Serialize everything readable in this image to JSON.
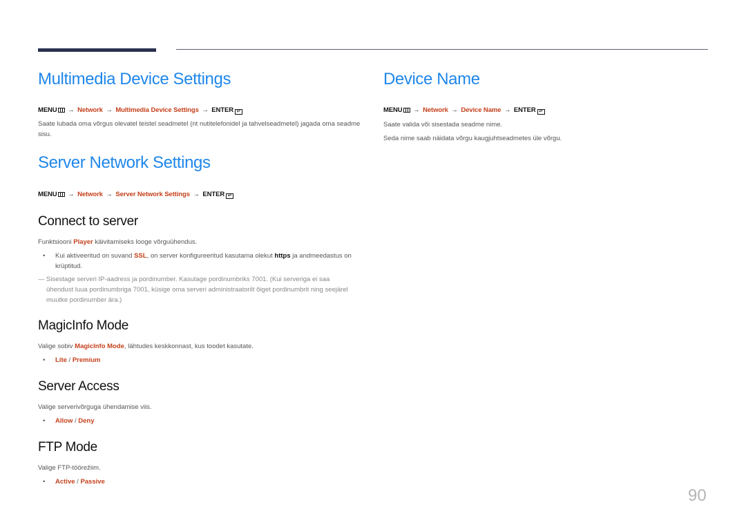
{
  "page_number": "90",
  "sections": {
    "multimedia": {
      "title": "Multimedia Device Settings",
      "path": {
        "menu": "MENU",
        "network": "Network",
        "item": "Multimedia Device Settings",
        "enter": "ENTER",
        "arrow": "→"
      },
      "description": "Saate lubada oma võrgus olevatel teistel seadmetel (nt nutitelefonidel ja tahvelseadmetel) jagada oma seadme sisu."
    },
    "server_network": {
      "title": "Server Network Settings",
      "path": {
        "menu": "MENU",
        "network": "Network",
        "item": "Server Network Settings",
        "enter": "ENTER",
        "arrow": "→"
      }
    },
    "connect_to_server": {
      "title": "Connect to server",
      "desc_pre": "Funktsiooni ",
      "desc_highlight": "Player",
      "desc_post": " käivitamiseks looge võrguühendus.",
      "bullet_pre": "Kui aktiveeritud on suvand ",
      "bullet_ssl": "SSL",
      "bullet_mid": ", on server konfigureeritud kasutama olekut ",
      "bullet_https": "https",
      "bullet_post": " ja andmeedastus on krüptitud.",
      "note": "Sisestage serveri IP-aadress ja pordinumber. Kasutage pordinumbriks 7001. (Kui serveriga ei saa ühendust luua pordinumbriga 7001, küsige oma serveri administraatorilt õiget pordinumbrit ning seejärel muutke pordinumber ära.)"
    },
    "magicinfo_mode": {
      "title": "MagicInfo Mode",
      "desc_pre": "Valige sobiv ",
      "desc_highlight": "MagicInfo Mode",
      "desc_post": ", lähtudes keskkonnast, kus toodet kasutate.",
      "options": [
        "Lite",
        "Premium"
      ]
    },
    "server_access": {
      "title": "Server Access",
      "description": "Valige serverivõrguga ühendamise viis.",
      "options": [
        "Allow",
        "Deny"
      ]
    },
    "ftp_mode": {
      "title": "FTP Mode",
      "description": "Valige FTP-töörežiim.",
      "options": [
        "Active",
        "Passive"
      ]
    },
    "device_name": {
      "title": "Device Name",
      "path": {
        "menu": "MENU",
        "network": "Network",
        "item": "Device Name",
        "enter": "ENTER",
        "arrow": "→"
      },
      "description_1": "Saate valida või sisestada seadme nime.",
      "description_2": "Seda nime saab näidata võrgu kaugjuhtseadmetes üle võrgu."
    }
  },
  "bullet_char": "•",
  "option_separator": "/",
  "note_dash": "—",
  "colors": {
    "heading_blue": "#1f87ea",
    "highlight_red": "#c5401b",
    "rule_dark": "#2b3150"
  }
}
